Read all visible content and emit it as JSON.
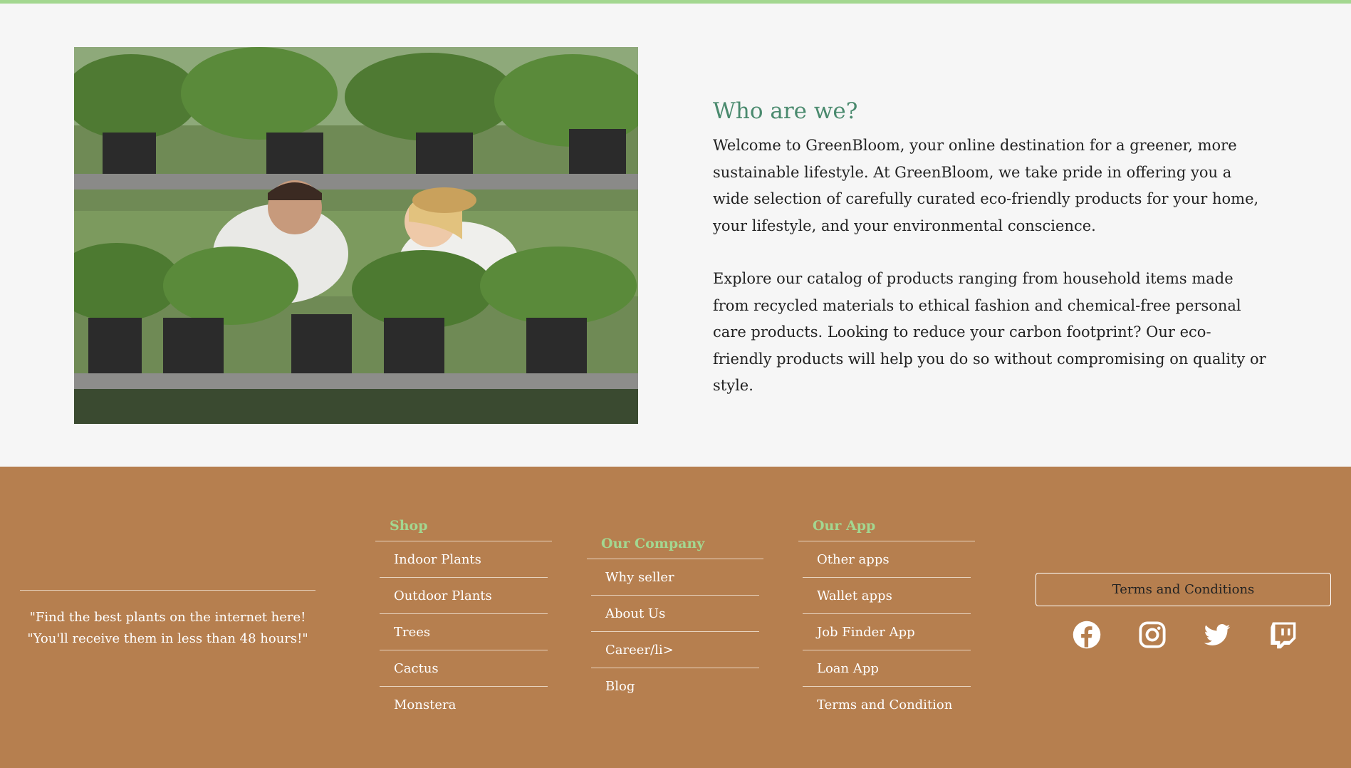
{
  "about": {
    "title": "Who are we?",
    "paragraph_1": "Welcome to GreenBloom, your online destination for a greener, more sustainable lifestyle. At GreenBloom, we take pride in offering you a wide selection of carefully curated eco-friendly products for your home, your lifestyle, and your environmental conscience.",
    "paragraph_2": "Explore our catalog of products ranging from household items made from recycled materials to ethical fashion and chemical-free personal care products. Looking to reduce your carbon footprint? Our eco-friendly products will help you do so without compromising on quality or style."
  },
  "footer": {
    "tagline": "\"Find the best plants on the internet here! \"You'll receive them in less than 48 hours!\"",
    "shop": {
      "title": "Shop",
      "items": [
        "Indoor Plants",
        "Outdoor Plants",
        "Trees",
        "Cactus",
        "Monstera"
      ]
    },
    "company": {
      "title": "Our Company",
      "items": [
        "Why seller",
        "About Us",
        "Career/li>",
        "Blog"
      ]
    },
    "app": {
      "title": "Our App",
      "items": [
        "Other apps",
        "Wallet apps",
        "Job Finder App",
        "Loan App",
        "Terms and Condition"
      ]
    },
    "terms_button": "Terms and Conditions",
    "socials": [
      "facebook-icon",
      "instagram-icon",
      "twitter-icon",
      "twitch-icon"
    ]
  },
  "colors": {
    "accent_green": "#a3d790",
    "title_green": "#4a8a6e",
    "footer_brown": "#b67f4f",
    "background": "#f6f6f6"
  }
}
